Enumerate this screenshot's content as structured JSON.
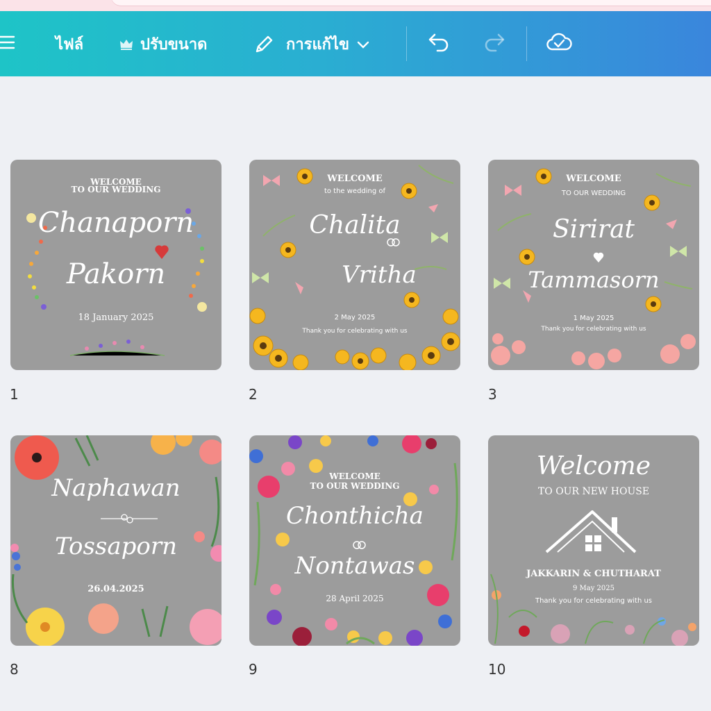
{
  "toolbar": {
    "file_label": "ไฟล์",
    "resize_label": "ปรับขนาด",
    "edit_label": "การแก้ไข"
  },
  "colors": {
    "toolbar_gradient_start": "#1ec4c7",
    "toolbar_gradient_end": "#3a86dc",
    "card_background": "#9c9c9c",
    "page_background": "#eef0f4"
  },
  "pages": [
    {
      "number": "1",
      "lines": [
        "WELCOME",
        "TO OUR WEDDING"
      ],
      "name1": "Chanaporn",
      "name2": "Pakorn",
      "date": "18 January 2025"
    },
    {
      "number": "2",
      "lines": [
        "WELCOME",
        "to the wedding of"
      ],
      "name1": "Chalita",
      "name2": "Vritha",
      "date": "2 May 2025",
      "footer": "Thank you for celebrating with us"
    },
    {
      "number": "3",
      "lines": [
        "WELCOME",
        "TO OUR WEDDING"
      ],
      "name1": "Sirirat",
      "name2": "Tammasorn",
      "date": "1 May 2025",
      "footer": "Thank you for celebrating with us"
    },
    {
      "number": "8",
      "name1": "Naphawan",
      "name2": "Tossaporn",
      "date": "26.04.2025"
    },
    {
      "number": "9",
      "lines": [
        "WELCOME",
        "TO OUR WEDDING"
      ],
      "name1": "Chonthicha",
      "name2": "Nontawas",
      "date": "28 April 2025"
    },
    {
      "number": "10",
      "script": "Welcome",
      "lines": [
        "TO OUR NEW HOUSE"
      ],
      "names": "JAKKARIN & CHUTHARAT",
      "date": "9 May 2025",
      "footer": "Thank you for celebrating with us"
    }
  ]
}
